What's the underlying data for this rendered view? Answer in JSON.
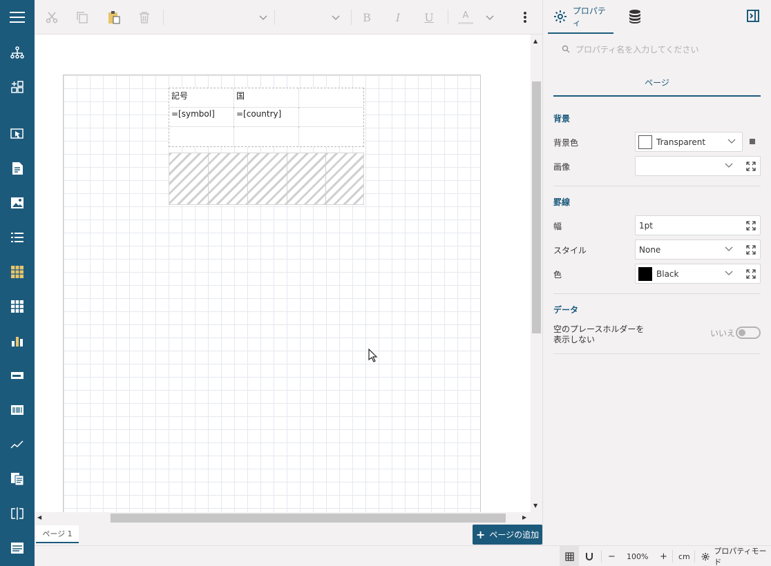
{
  "leftbar": {
    "items": [
      "menu-icon",
      "hierarchy-icon",
      "add-component-icon",
      "select-pointer-icon",
      "textbox-icon",
      "image-icon",
      "list-icon",
      "table-icon",
      "tablix-icon",
      "chart-icon",
      "progress-bar-icon",
      "barcode-icon",
      "sparkline-icon",
      "subreport-icon",
      "split-icon",
      "banded-list-icon"
    ]
  },
  "toolbar": {
    "bold": "B",
    "italic": "I",
    "underline": "U",
    "font_color": "A"
  },
  "canvas": {
    "table": {
      "header": [
        "記号",
        "国",
        ""
      ],
      "data": [
        "=[symbol]",
        "=[country]",
        ""
      ]
    }
  },
  "pages": {
    "tab_label": "ページ 1",
    "add_label": "ページの追加"
  },
  "right_panel": {
    "properties_tab": "プロパティ",
    "search_placeholder": "プロパティ名を入力してください",
    "section_tab": "ページ",
    "groups": {
      "background": {
        "title": "背景",
        "bg_color_label": "背景色",
        "bg_color_value": "Transparent",
        "bg_color_swatch": "#ffffff",
        "image_label": "画像",
        "image_value": ""
      },
      "border": {
        "title": "罫線",
        "width_label": "幅",
        "width_value": "1pt",
        "style_label": "スタイル",
        "style_value": "None",
        "color_label": "色",
        "color_value": "Black",
        "color_swatch": "#000000"
      },
      "data": {
        "title": "データ",
        "empty_placeholder_label_line1": "空のプレースホルダーを",
        "empty_placeholder_label_line2": "表示しない",
        "toggle_state_label": "いいえ"
      }
    }
  },
  "statusbar": {
    "zoom_minus": "−",
    "zoom": "100%",
    "zoom_plus": "+",
    "unit": "cm",
    "mode": "プロパティモード"
  },
  "colors": {
    "accent": "#1c5a7c",
    "sidebar": "#1c5a7c",
    "background": "#f3f1f2"
  }
}
